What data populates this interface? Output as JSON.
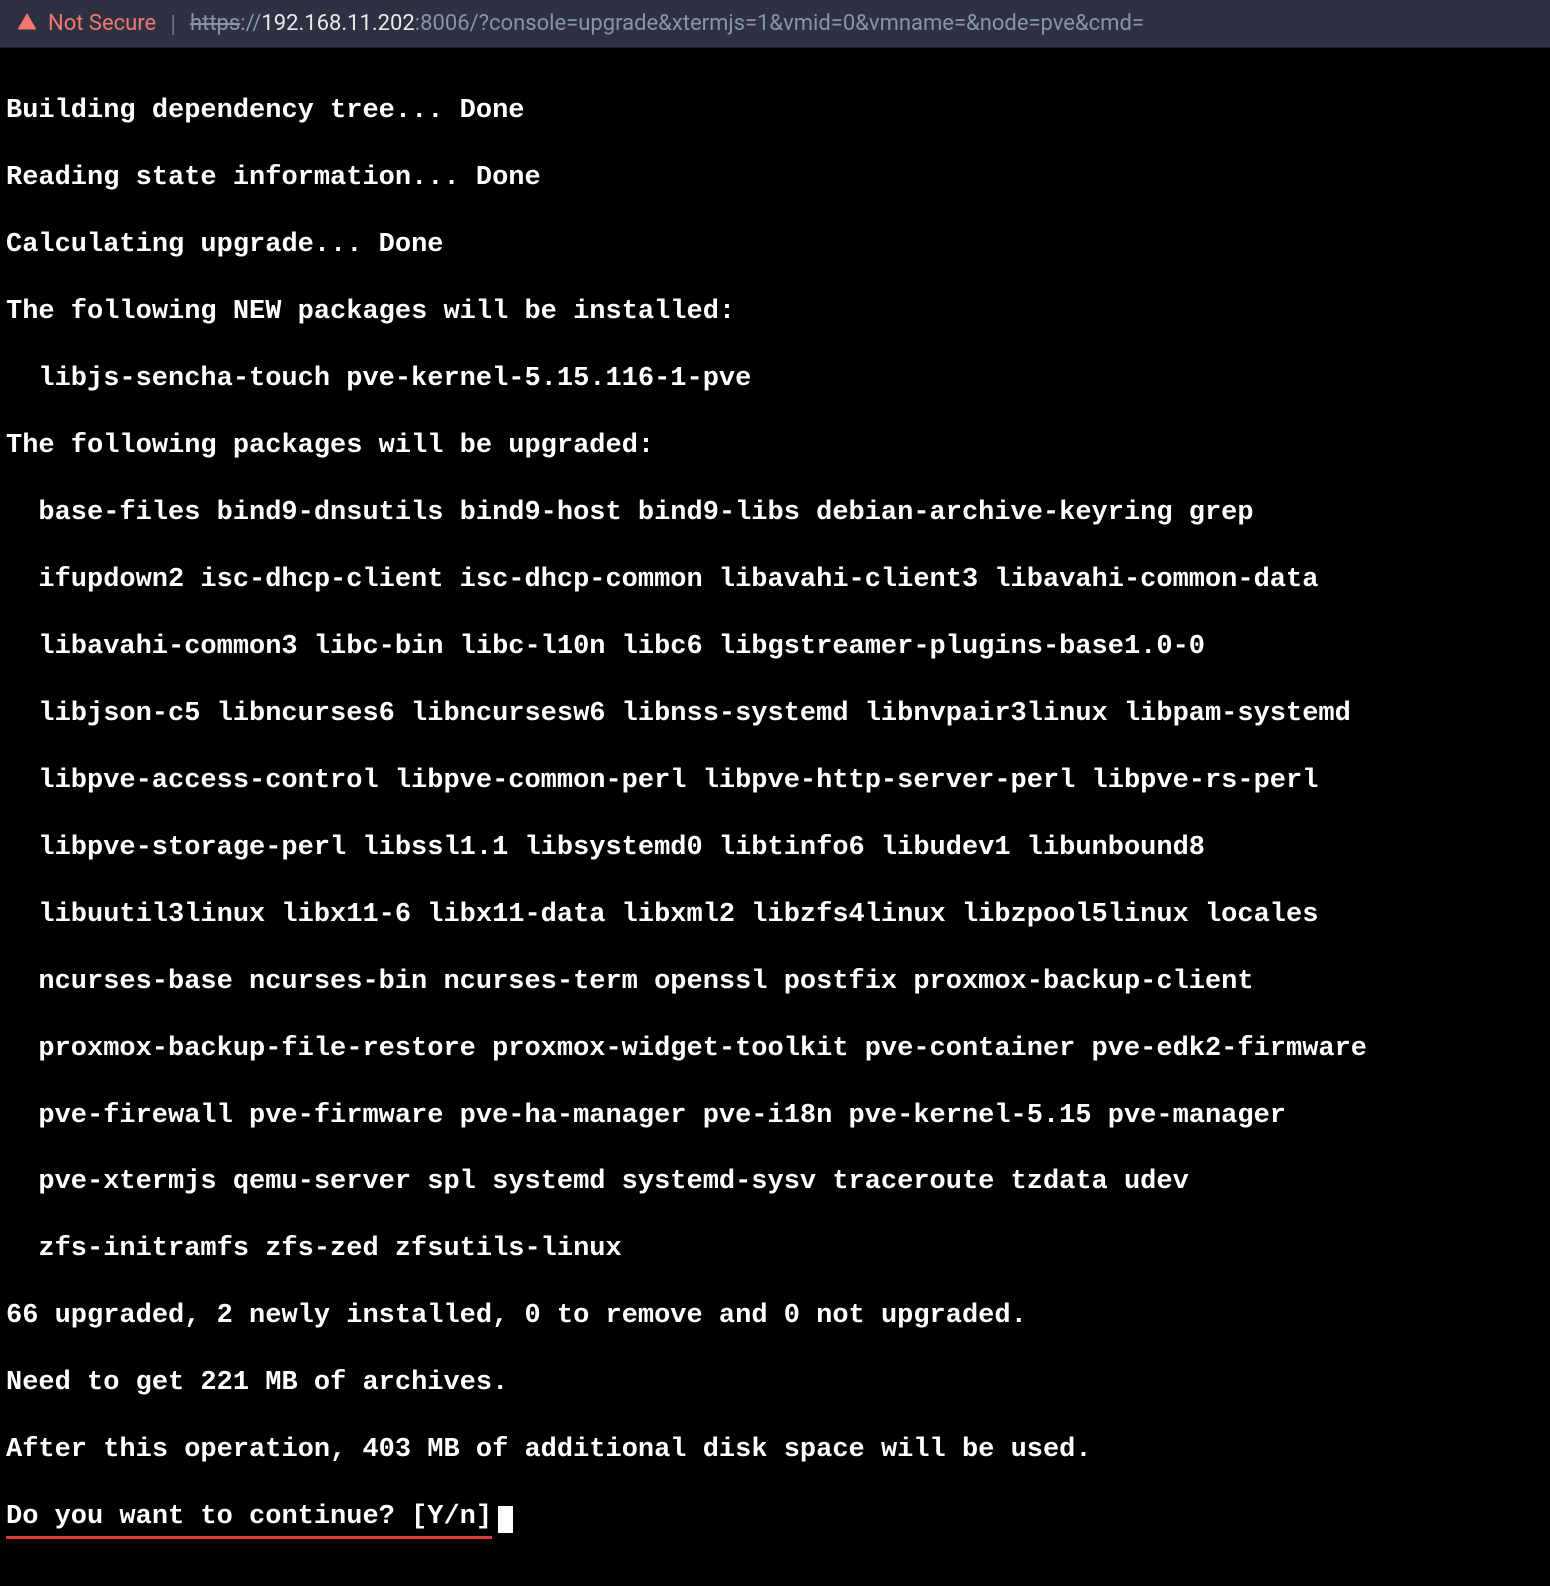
{
  "address_bar": {
    "not_secure_label": "Not Secure",
    "protocol": "https",
    "slashes": "://",
    "host": "192.168.11.202",
    "port_path": ":8006/?console=upgrade&xtermjs=1&vmid=0&vmname=&node=pve&cmd="
  },
  "terminal": {
    "lines": [
      "Building dependency tree... Done",
      "Reading state information... Done",
      "Calculating upgrade... Done",
      "The following NEW packages will be installed:"
    ],
    "new_packages": "libjs-sencha-touch pve-kernel-5.15.116-1-pve",
    "upgraded_heading": "The following packages will be upgraded:",
    "upgraded_packages": [
      "base-files bind9-dnsutils bind9-host bind9-libs debian-archive-keyring grep",
      "ifupdown2 isc-dhcp-client isc-dhcp-common libavahi-client3 libavahi-common-data",
      "libavahi-common3 libc-bin libc-l10n libc6 libgstreamer-plugins-base1.0-0",
      "libjson-c5 libncurses6 libncursesw6 libnss-systemd libnvpair3linux libpam-systemd",
      "libpve-access-control libpve-common-perl libpve-http-server-perl libpve-rs-perl",
      "libpve-storage-perl libssl1.1 libsystemd0 libtinfo6 libudev1 libunbound8",
      "libuutil3linux libx11-6 libx11-data libxml2 libzfs4linux libzpool5linux locales",
      "ncurses-base ncurses-bin ncurses-term openssl postfix proxmox-backup-client",
      "proxmox-backup-file-restore proxmox-widget-toolkit pve-container pve-edk2-firmware",
      "pve-firewall pve-firmware pve-ha-manager pve-i18n pve-kernel-5.15 pve-manager",
      "pve-xtermjs qemu-server spl systemd systemd-sysv traceroute tzdata udev",
      "zfs-initramfs zfs-zed zfsutils-linux"
    ],
    "summary": [
      "66 upgraded, 2 newly installed, 0 to remove and 0 not upgraded.",
      "Need to get 221 MB of archives.",
      "After this operation, 403 MB of additional disk space will be used."
    ],
    "prompt": "Do you want to continue? [Y/n]"
  }
}
